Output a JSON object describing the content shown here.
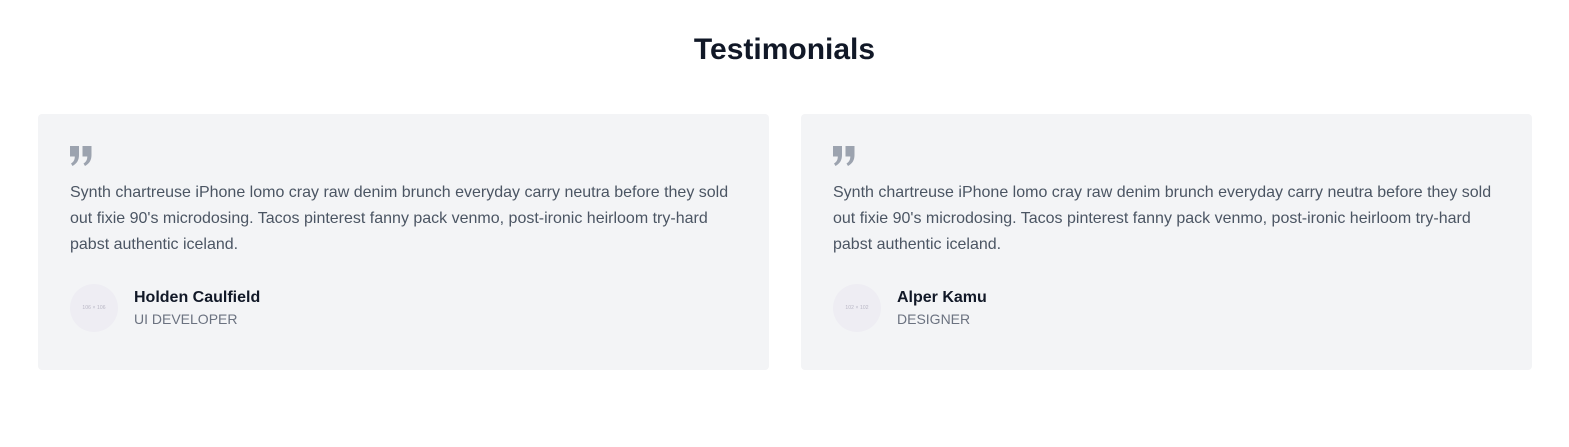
{
  "section": {
    "title": "Testimonials"
  },
  "colors": {
    "card_background": "#f3f4f6",
    "quote_icon": "#9ca3af",
    "body_text": "#4b5563",
    "heading": "#111827",
    "role_text": "#6b7280"
  },
  "testimonials": [
    {
      "icon": "quote-icon",
      "quote": "Synth chartreuse iPhone lomo cray raw denim brunch everyday carry neutra before they sold out fixie 90's microdosing. Tacos pinterest fanny pack venmo, post-ironic heirloom try-hard pabst authentic iceland.",
      "avatar_text": "106 × 106",
      "name": "Holden Caulfield",
      "role": "UI DEVELOPER"
    },
    {
      "icon": "quote-icon",
      "quote": "Synth chartreuse iPhone lomo cray raw denim brunch everyday carry neutra before they sold out fixie 90's microdosing. Tacos pinterest fanny pack venmo, post-ironic heirloom try-hard pabst authentic iceland.",
      "avatar_text": "102 × 102",
      "name": "Alper Kamu",
      "role": "DESIGNER"
    }
  ]
}
